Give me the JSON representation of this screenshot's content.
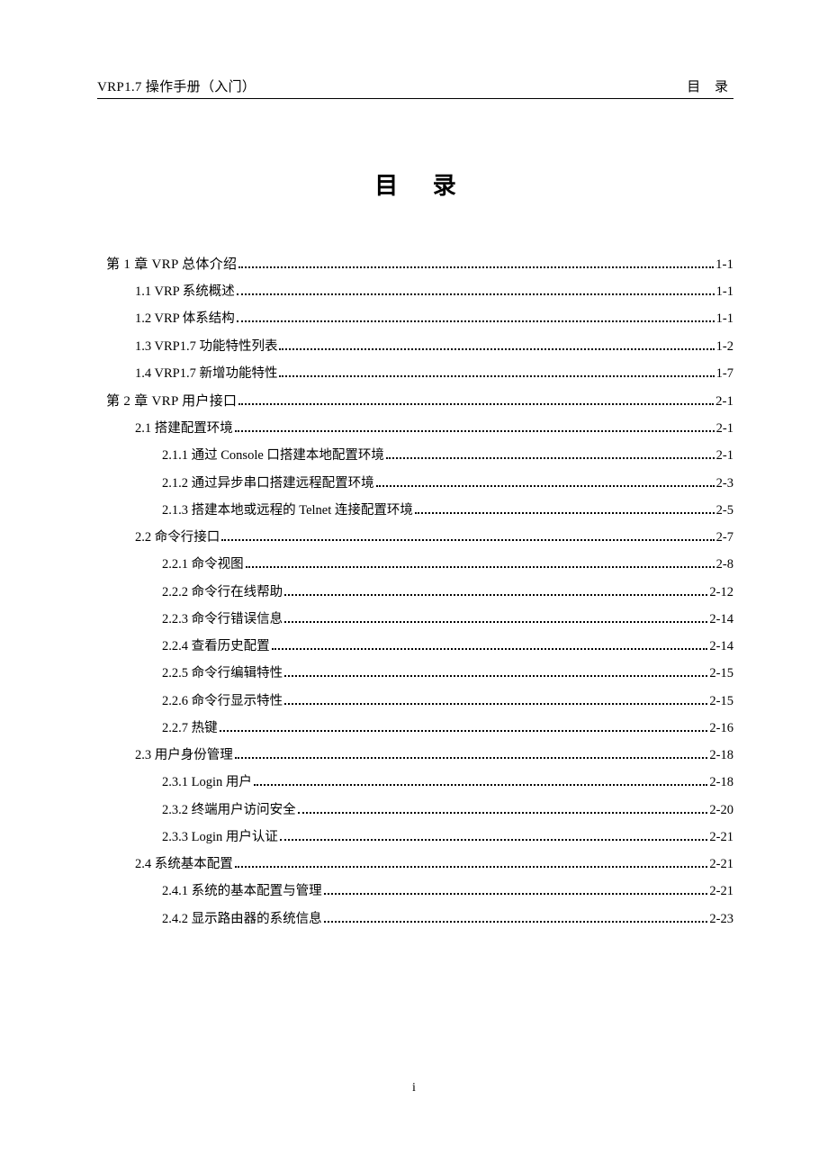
{
  "header": {
    "left": "VRP1.7   操作手册（入门）",
    "right": "目 录"
  },
  "title": "目  录",
  "page_number": "i",
  "toc": [
    {
      "level": "chapter",
      "label": "第 1 章  VRP 总体介绍",
      "page": "1-1"
    },
    {
      "level": "section",
      "label": "1.1 VRP 系统概述",
      "page": "1-1"
    },
    {
      "level": "section",
      "label": "1.2 VRP 体系结构",
      "page": "1-1"
    },
    {
      "level": "section",
      "label": "1.3 VRP1.7 功能特性列表",
      "page": "1-2"
    },
    {
      "level": "section",
      "label": "1.4 VRP1.7 新增功能特性",
      "page": "1-7"
    },
    {
      "level": "chapter",
      "label": "第 2 章  VRP 用户接口",
      "page": "2-1"
    },
    {
      "level": "section",
      "label": "2.1  搭建配置环境",
      "page": "2-1"
    },
    {
      "level": "subsection",
      "label": "2.1.1  通过 Console 口搭建本地配置环境",
      "page": "2-1"
    },
    {
      "level": "subsection",
      "label": "2.1.2  通过异步串口搭建远程配置环境",
      "page": "2-3"
    },
    {
      "level": "subsection",
      "label": "2.1.3  搭建本地或远程的 Telnet 连接配置环境",
      "page": "2-5"
    },
    {
      "level": "section",
      "label": "2.2  命令行接口",
      "page": "2-7"
    },
    {
      "level": "subsection",
      "label": "2.2.1  命令视图",
      "page": "2-8"
    },
    {
      "level": "subsection",
      "label": "2.2.2  命令行在线帮助",
      "page": "2-12"
    },
    {
      "level": "subsection",
      "label": "2.2.3  命令行错误信息",
      "page": "2-14"
    },
    {
      "level": "subsection",
      "label": "2.2.4  查看历史配置",
      "page": "2-14"
    },
    {
      "level": "subsection",
      "label": "2.2.5  命令行编辑特性",
      "page": "2-15"
    },
    {
      "level": "subsection",
      "label": "2.2.6  命令行显示特性",
      "page": "2-15"
    },
    {
      "level": "subsection",
      "label": "2.2.7  热键",
      "page": "2-16"
    },
    {
      "level": "section",
      "label": "2.3  用户身份管理",
      "page": "2-18"
    },
    {
      "level": "subsection",
      "label": "2.3.1 Login 用户",
      "page": "2-18"
    },
    {
      "level": "subsection",
      "label": "2.3.2  终端用户访问安全",
      "page": "2-20"
    },
    {
      "level": "subsection",
      "label": "2.3.3 Login 用户认证",
      "page": "2-21"
    },
    {
      "level": "section",
      "label": "2.4  系统基本配置",
      "page": "2-21"
    },
    {
      "level": "subsection",
      "label": "2.4.1  系统的基本配置与管理",
      "page": "2-21"
    },
    {
      "level": "subsection",
      "label": "2.4.2  显示路由器的系统信息",
      "page": "2-23"
    }
  ]
}
